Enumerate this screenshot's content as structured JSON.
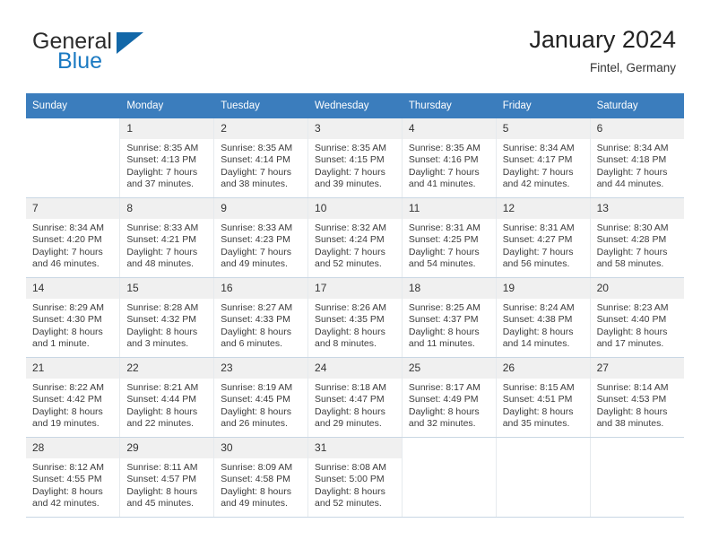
{
  "brand": {
    "name_part1": "General",
    "name_part2": "Blue",
    "flag_icon": "blue-triangle-flag-icon",
    "color_primary": "#1267a8",
    "color_text": "#2b2b2b"
  },
  "header": {
    "title": "January 2024",
    "subtitle": "Fintel, Germany"
  },
  "calendar": {
    "header_bg": "#3b7dbd",
    "daynum_bg": "#f0f0f0",
    "weekday_labels": [
      "Sunday",
      "Monday",
      "Tuesday",
      "Wednesday",
      "Thursday",
      "Friday",
      "Saturday"
    ],
    "labels": {
      "sunrise": "Sunrise:",
      "sunset": "Sunset:",
      "daylight": "Daylight:"
    },
    "weeks": [
      [
        {
          "day": "",
          "lines": [
            "",
            "",
            "",
            ""
          ]
        },
        {
          "day": "1",
          "lines": [
            "Sunrise: 8:35 AM",
            "Sunset: 4:13 PM",
            "Daylight: 7 hours",
            "and 37 minutes."
          ]
        },
        {
          "day": "2",
          "lines": [
            "Sunrise: 8:35 AM",
            "Sunset: 4:14 PM",
            "Daylight: 7 hours",
            "and 38 minutes."
          ]
        },
        {
          "day": "3",
          "lines": [
            "Sunrise: 8:35 AM",
            "Sunset: 4:15 PM",
            "Daylight: 7 hours",
            "and 39 minutes."
          ]
        },
        {
          "day": "4",
          "lines": [
            "Sunrise: 8:35 AM",
            "Sunset: 4:16 PM",
            "Daylight: 7 hours",
            "and 41 minutes."
          ]
        },
        {
          "day": "5",
          "lines": [
            "Sunrise: 8:34 AM",
            "Sunset: 4:17 PM",
            "Daylight: 7 hours",
            "and 42 minutes."
          ]
        },
        {
          "day": "6",
          "lines": [
            "Sunrise: 8:34 AM",
            "Sunset: 4:18 PM",
            "Daylight: 7 hours",
            "and 44 minutes."
          ]
        }
      ],
      [
        {
          "day": "7",
          "lines": [
            "Sunrise: 8:34 AM",
            "Sunset: 4:20 PM",
            "Daylight: 7 hours",
            "and 46 minutes."
          ]
        },
        {
          "day": "8",
          "lines": [
            "Sunrise: 8:33 AM",
            "Sunset: 4:21 PM",
            "Daylight: 7 hours",
            "and 48 minutes."
          ]
        },
        {
          "day": "9",
          "lines": [
            "Sunrise: 8:33 AM",
            "Sunset: 4:23 PM",
            "Daylight: 7 hours",
            "and 49 minutes."
          ]
        },
        {
          "day": "10",
          "lines": [
            "Sunrise: 8:32 AM",
            "Sunset: 4:24 PM",
            "Daylight: 7 hours",
            "and 52 minutes."
          ]
        },
        {
          "day": "11",
          "lines": [
            "Sunrise: 8:31 AM",
            "Sunset: 4:25 PM",
            "Daylight: 7 hours",
            "and 54 minutes."
          ]
        },
        {
          "day": "12",
          "lines": [
            "Sunrise: 8:31 AM",
            "Sunset: 4:27 PM",
            "Daylight: 7 hours",
            "and 56 minutes."
          ]
        },
        {
          "day": "13",
          "lines": [
            "Sunrise: 8:30 AM",
            "Sunset: 4:28 PM",
            "Daylight: 7 hours",
            "and 58 minutes."
          ]
        }
      ],
      [
        {
          "day": "14",
          "lines": [
            "Sunrise: 8:29 AM",
            "Sunset: 4:30 PM",
            "Daylight: 8 hours",
            "and 1 minute."
          ]
        },
        {
          "day": "15",
          "lines": [
            "Sunrise: 8:28 AM",
            "Sunset: 4:32 PM",
            "Daylight: 8 hours",
            "and 3 minutes."
          ]
        },
        {
          "day": "16",
          "lines": [
            "Sunrise: 8:27 AM",
            "Sunset: 4:33 PM",
            "Daylight: 8 hours",
            "and 6 minutes."
          ]
        },
        {
          "day": "17",
          "lines": [
            "Sunrise: 8:26 AM",
            "Sunset: 4:35 PM",
            "Daylight: 8 hours",
            "and 8 minutes."
          ]
        },
        {
          "day": "18",
          "lines": [
            "Sunrise: 8:25 AM",
            "Sunset: 4:37 PM",
            "Daylight: 8 hours",
            "and 11 minutes."
          ]
        },
        {
          "day": "19",
          "lines": [
            "Sunrise: 8:24 AM",
            "Sunset: 4:38 PM",
            "Daylight: 8 hours",
            "and 14 minutes."
          ]
        },
        {
          "day": "20",
          "lines": [
            "Sunrise: 8:23 AM",
            "Sunset: 4:40 PM",
            "Daylight: 8 hours",
            "and 17 minutes."
          ]
        }
      ],
      [
        {
          "day": "21",
          "lines": [
            "Sunrise: 8:22 AM",
            "Sunset: 4:42 PM",
            "Daylight: 8 hours",
            "and 19 minutes."
          ]
        },
        {
          "day": "22",
          "lines": [
            "Sunrise: 8:21 AM",
            "Sunset: 4:44 PM",
            "Daylight: 8 hours",
            "and 22 minutes."
          ]
        },
        {
          "day": "23",
          "lines": [
            "Sunrise: 8:19 AM",
            "Sunset: 4:45 PM",
            "Daylight: 8 hours",
            "and 26 minutes."
          ]
        },
        {
          "day": "24",
          "lines": [
            "Sunrise: 8:18 AM",
            "Sunset: 4:47 PM",
            "Daylight: 8 hours",
            "and 29 minutes."
          ]
        },
        {
          "day": "25",
          "lines": [
            "Sunrise: 8:17 AM",
            "Sunset: 4:49 PM",
            "Daylight: 8 hours",
            "and 32 minutes."
          ]
        },
        {
          "day": "26",
          "lines": [
            "Sunrise: 8:15 AM",
            "Sunset: 4:51 PM",
            "Daylight: 8 hours",
            "and 35 minutes."
          ]
        },
        {
          "day": "27",
          "lines": [
            "Sunrise: 8:14 AM",
            "Sunset: 4:53 PM",
            "Daylight: 8 hours",
            "and 38 minutes."
          ]
        }
      ],
      [
        {
          "day": "28",
          "lines": [
            "Sunrise: 8:12 AM",
            "Sunset: 4:55 PM",
            "Daylight: 8 hours",
            "and 42 minutes."
          ]
        },
        {
          "day": "29",
          "lines": [
            "Sunrise: 8:11 AM",
            "Sunset: 4:57 PM",
            "Daylight: 8 hours",
            "and 45 minutes."
          ]
        },
        {
          "day": "30",
          "lines": [
            "Sunrise: 8:09 AM",
            "Sunset: 4:58 PM",
            "Daylight: 8 hours",
            "and 49 minutes."
          ]
        },
        {
          "day": "31",
          "lines": [
            "Sunrise: 8:08 AM",
            "Sunset: 5:00 PM",
            "Daylight: 8 hours",
            "and 52 minutes."
          ]
        },
        {
          "day": "",
          "lines": [
            "",
            "",
            "",
            ""
          ]
        },
        {
          "day": "",
          "lines": [
            "",
            "",
            "",
            ""
          ]
        },
        {
          "day": "",
          "lines": [
            "",
            "",
            "",
            ""
          ]
        }
      ]
    ]
  }
}
